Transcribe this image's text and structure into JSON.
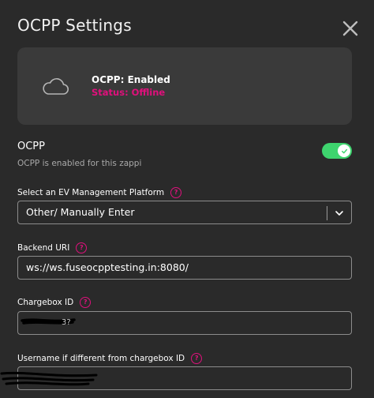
{
  "dialog": {
    "title": "OCPP Settings",
    "close_icon": "close-icon"
  },
  "status": {
    "icon": "cloud-icon",
    "title": "OCPP: Enabled",
    "subtitle": "Status: Offline",
    "subtitle_color": "#e0107c"
  },
  "ocpp": {
    "label": "OCPP",
    "description": "OCPP is enabled for this zappi",
    "enabled": true,
    "toggle_color": "#3ed46e"
  },
  "platform": {
    "label": "Select an EV Management Platform",
    "selected": "Other/ Manually Enter"
  },
  "backend": {
    "label": "Backend URI",
    "value": "ws://ws.fuseocpptesting.in:8080/"
  },
  "chargebox": {
    "label": "Chargebox ID",
    "value": "",
    "redacted": true
  },
  "username": {
    "label": "Username if different from chargebox ID",
    "value": "",
    "redacted": true
  },
  "help_glyph": "?",
  "accent_color": "#e0107c"
}
